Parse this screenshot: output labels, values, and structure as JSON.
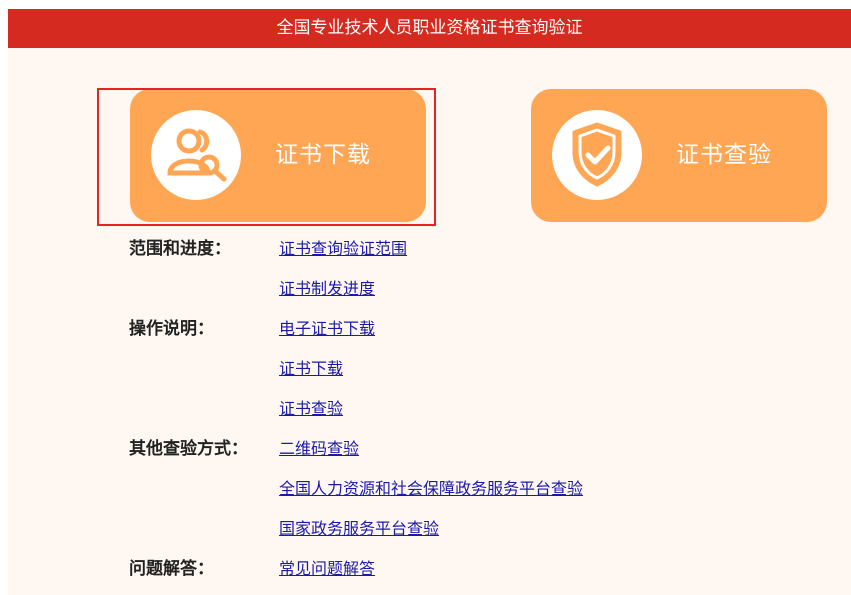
{
  "header": {
    "title": "全国专业技术人员职业资格证书查询验证"
  },
  "tiles": {
    "download": {
      "label": "证书下载",
      "icon": "user-search-icon",
      "selected": true
    },
    "verify": {
      "label": "证书查验",
      "icon": "shield-check-icon"
    }
  },
  "colors": {
    "header_bg": "#d42a20",
    "tile_bg": "#ffa654",
    "selection_border": "#e32324",
    "link": "#1a1aa8",
    "page_bg": "#fff8f2"
  },
  "sections": {
    "scope": {
      "label": "范围和进度：",
      "links": [
        "证书查询验证范围",
        "证书制发进度"
      ]
    },
    "instructions": {
      "label": "操作说明：",
      "links": [
        "电子证书下载",
        "证书下载",
        "证书查验"
      ]
    },
    "other": {
      "label": "其他查验方式：",
      "links": [
        "二维码查验",
        "全国人力资源和社会保障政务服务平台查验",
        "国家政务服务平台查验"
      ]
    },
    "faq": {
      "label": "问题解答：",
      "links": [
        "常见问题解答"
      ]
    }
  }
}
